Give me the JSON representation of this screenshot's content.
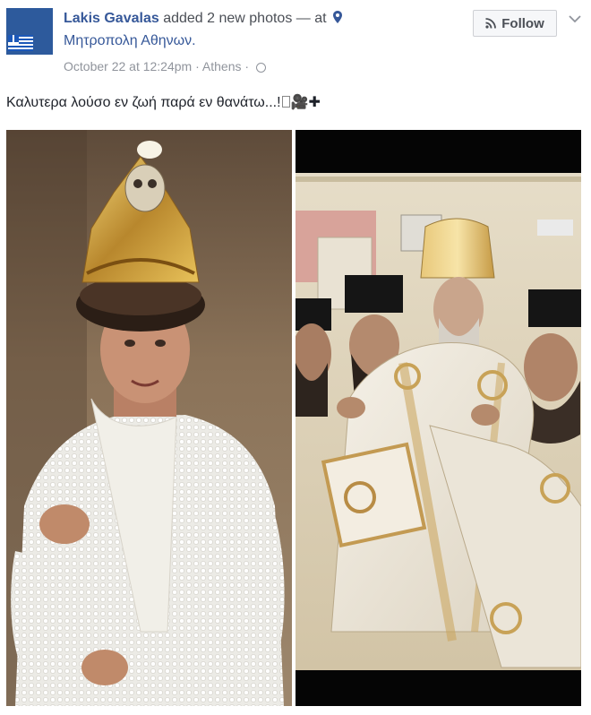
{
  "post": {
    "author": "Lakis Gavalas",
    "action": "added 2 new photos — at",
    "location": "Μητροπολη Αθηνων.",
    "timestamp": "October 22 at 12:24pm",
    "separator": "·",
    "place": "Athens",
    "follow_label": "Follow",
    "text": "Καλυτερα λούσο εν ζωή παρά εν θανάτω...!",
    "text_emoji": "🎥✚"
  },
  "icons": {
    "location": "map-pin-icon",
    "privacy": "globe-icon",
    "follow": "rss-icon",
    "menu": "chevron-down-icon"
  },
  "colors": {
    "link": "#365899",
    "meta": "#90949c",
    "text": "#1d2129"
  }
}
